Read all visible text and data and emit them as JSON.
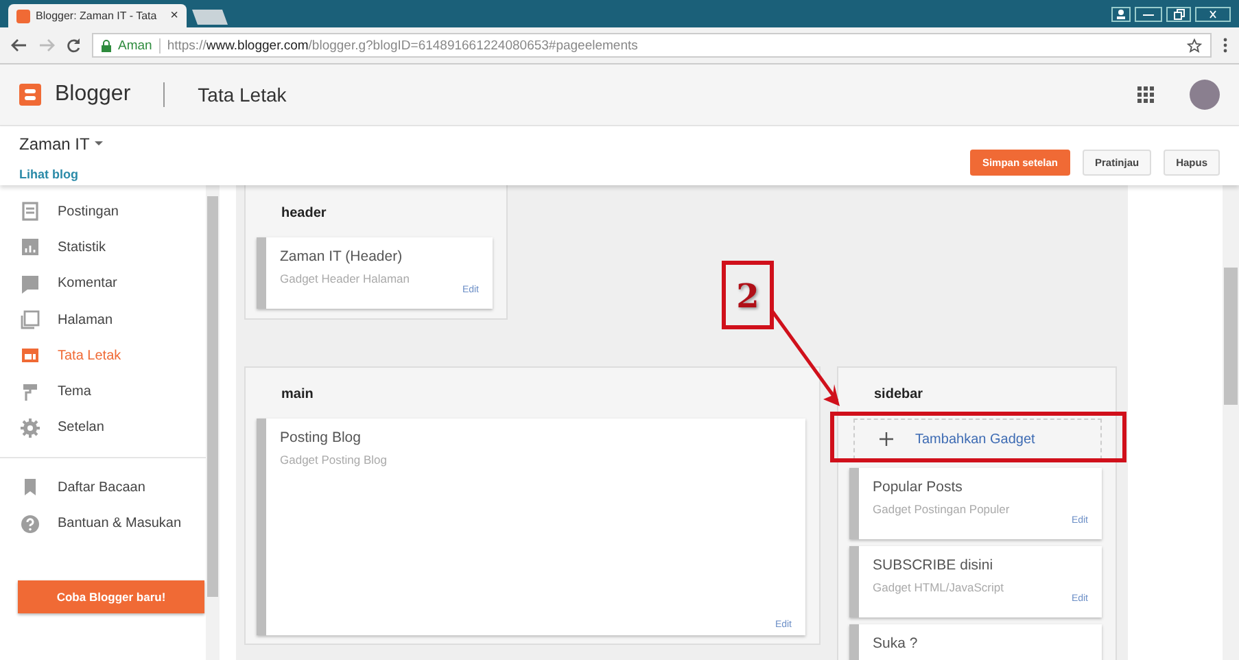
{
  "browser": {
    "tab_title": "Blogger: Zaman IT - Tata",
    "close": "×",
    "secure_label": "Aman",
    "url": "https://**www.blogger.com**/blogger.g?blogID=614891661224080653#pageelements"
  },
  "app_bar": {
    "brand": "Blogger",
    "page_title": "Tata Letak"
  },
  "blog": {
    "name": "Zaman IT",
    "view_link": "Lihat blog"
  },
  "actions": [
    {
      "label": "Simpan setelan",
      "kind": "primary"
    },
    {
      "label": "Pratinjau",
      "kind": "secondary"
    },
    {
      "label": "Hapus",
      "kind": "secondary"
    }
  ],
  "nav_groups": [
    [
      {
        "label": "Postingan",
        "selected": false
      },
      {
        "label": "Statistik",
        "selected": false
      },
      {
        "label": "Komentar",
        "selected": false
      },
      {
        "label": "Halaman",
        "selected": false
      },
      {
        "label": "Tata Letak",
        "selected": true
      },
      {
        "label": "Tema",
        "selected": false
      },
      {
        "label": "Setelan",
        "selected": false
      }
    ],
    [
      {
        "label": "Daftar Bacaan",
        "selected": false
      },
      {
        "label": "Bantuan & Masukan",
        "selected": false
      }
    ]
  ],
  "try_button": "Coba Blogger baru!",
  "sections": {
    "header": {
      "title": "header",
      "gadgets": [
        {
          "title": "Zaman IT (Header)",
          "subtitle": "Gadget Header Halaman",
          "edit": "Edit"
        }
      ]
    },
    "main": {
      "title": "main",
      "gadgets": [
        {
          "title": "Posting Blog",
          "subtitle": "Gadget Posting Blog",
          "edit": "Edit"
        }
      ]
    },
    "sidebar": {
      "title": "sidebar",
      "add_gadget": "Tambahkan Gadget",
      "gadgets": [
        {
          "title": "Popular Posts",
          "subtitle": "Gadget Postingan Populer",
          "edit": "Edit"
        },
        {
          "title": "SUBSCRIBE disini",
          "subtitle": "Gadget HTML/JavaScript",
          "edit": "Edit"
        },
        {
          "title": "Suka ?"
        }
      ]
    }
  },
  "annotation": {
    "label": "2"
  }
}
